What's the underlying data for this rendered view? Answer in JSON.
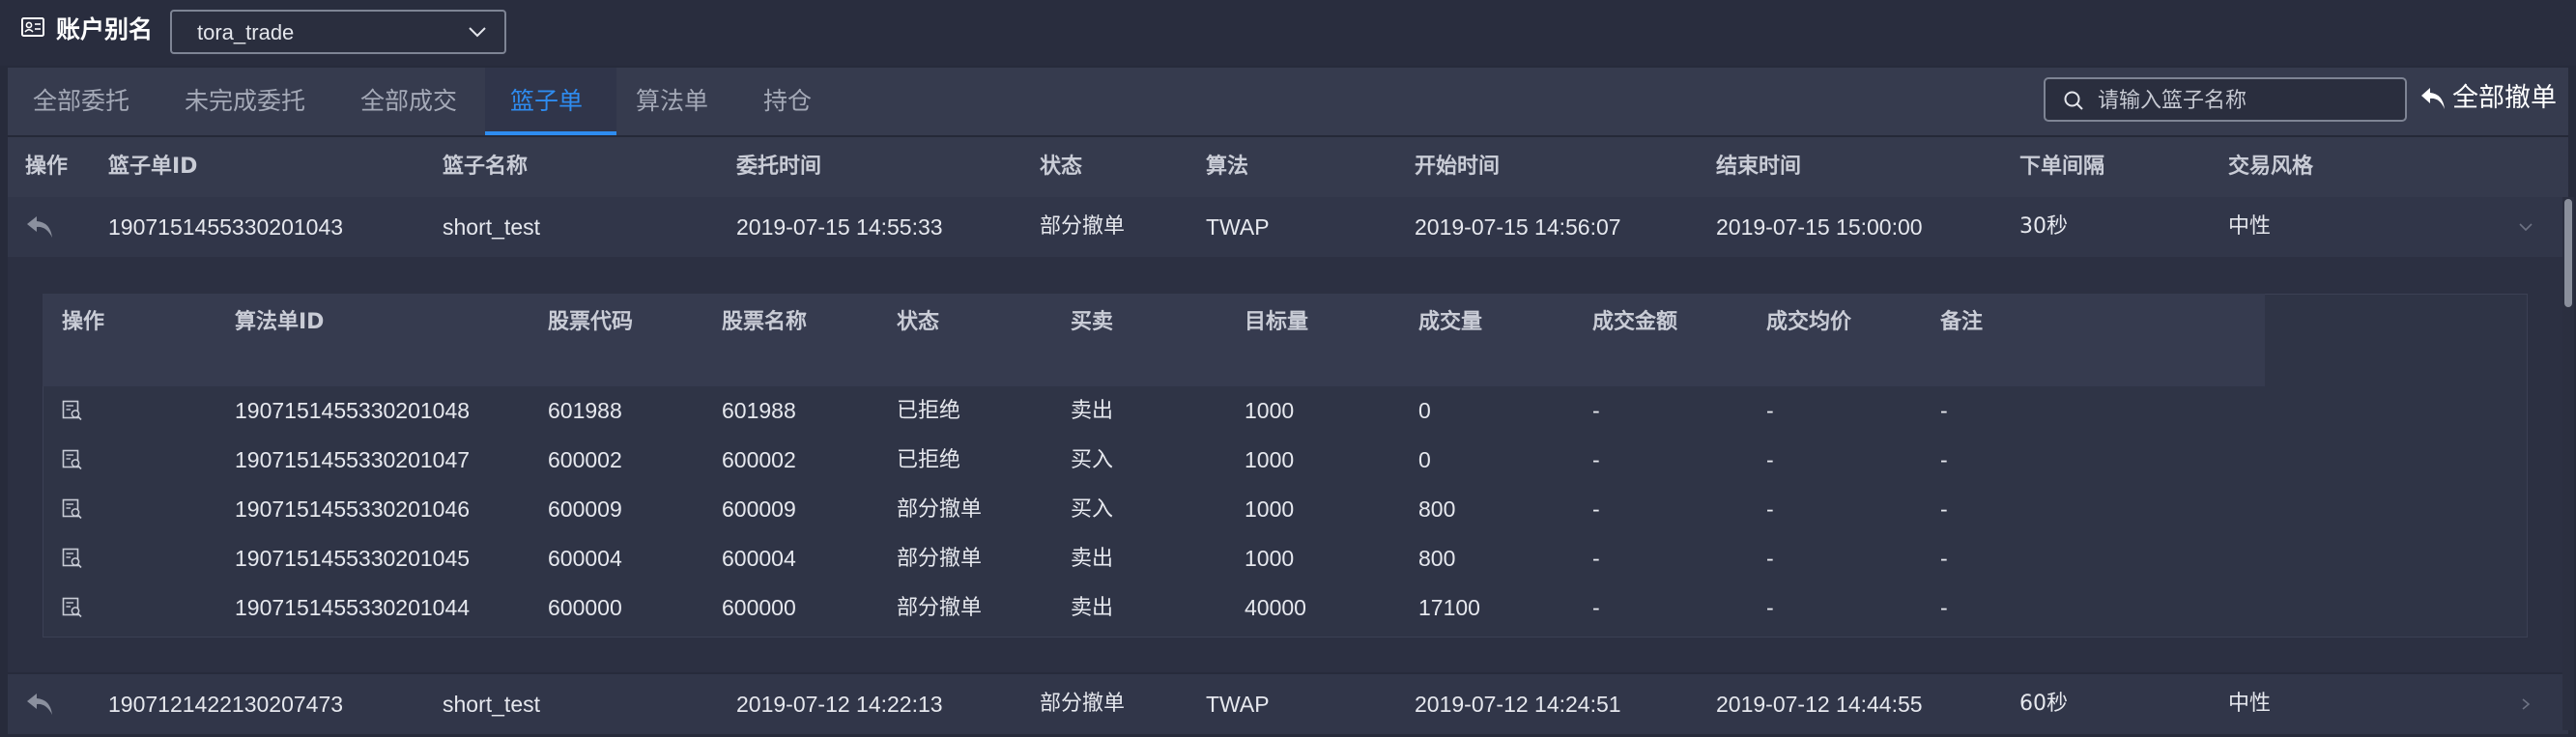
{
  "account": {
    "label": "账户别名",
    "selected": "tora_trade"
  },
  "tabs": [
    {
      "label": "全部委托"
    },
    {
      "label": "未完成委托"
    },
    {
      "label": "全部成交"
    },
    {
      "label": "篮子单",
      "active": true
    },
    {
      "label": "算法单"
    },
    {
      "label": "持仓"
    }
  ],
  "search": {
    "placeholder": "请输入篮子名称",
    "value": ""
  },
  "cancel_all": {
    "label": "全部撤单"
  },
  "main_columns": [
    "操作",
    "篮子单ID",
    "篮子名称",
    "委托时间",
    "状态",
    "算法",
    "开始时间",
    "结束时间",
    "下单间隔",
    "交易风格"
  ],
  "baskets": [
    {
      "id": "1907151455330201043",
      "name": "short_test",
      "order_time": "2019-07-15 14:55:33",
      "status": "部分撤单",
      "algo": "TWAP",
      "start_time": "2019-07-15 14:56:07",
      "end_time": "2019-07-15 15:00:00",
      "interval": "30秒",
      "style": "中性",
      "expanded": true
    },
    {
      "id": "1907121422130207473",
      "name": "short_test",
      "order_time": "2019-07-12 14:22:13",
      "status": "部分撤单",
      "algo": "TWAP",
      "start_time": "2019-07-12 14:24:51",
      "end_time": "2019-07-12 14:44:55",
      "interval": "60秒",
      "style": "中性",
      "expanded": false
    }
  ],
  "sub_columns": [
    "操作",
    "算法单ID",
    "股票代码",
    "股票名称",
    "状态",
    "买卖",
    "目标量",
    "成交量",
    "成交金额",
    "成交均价",
    "备注"
  ],
  "algo_orders": [
    {
      "id": "1907151455330201048",
      "code": "601988",
      "name": "601988",
      "status": "已拒绝",
      "side": "卖出",
      "target": "1000",
      "filled": "0",
      "amount": "-",
      "avg_price": "-",
      "note": "-"
    },
    {
      "id": "1907151455330201047",
      "code": "600002",
      "name": "600002",
      "status": "已拒绝",
      "side": "买入",
      "target": "1000",
      "filled": "0",
      "amount": "-",
      "avg_price": "-",
      "note": "-"
    },
    {
      "id": "1907151455330201046",
      "code": "600009",
      "name": "600009",
      "status": "部分撤单",
      "side": "买入",
      "target": "1000",
      "filled": "800",
      "amount": "-",
      "avg_price": "-",
      "note": "-"
    },
    {
      "id": "1907151455330201045",
      "code": "600004",
      "name": "600004",
      "status": "部分撤单",
      "side": "卖出",
      "target": "1000",
      "filled": "800",
      "amount": "-",
      "avg_price": "-",
      "note": "-"
    },
    {
      "id": "1907151455330201044",
      "code": "600000",
      "name": "600000",
      "status": "部分撤单",
      "side": "卖出",
      "target": "40000",
      "filled": "17100",
      "amount": "-",
      "avg_price": "-",
      "note": "-"
    }
  ],
  "icons": {
    "account": "account-card-icon",
    "select": "chevron-down-icon",
    "search": "search-icon",
    "cancel": "undo-arrow-icon",
    "row_action": "undo-arrow-icon",
    "detail": "detail-search-icon"
  },
  "colors": {
    "accent": "#2e8cf0",
    "background": "#272b3b"
  }
}
